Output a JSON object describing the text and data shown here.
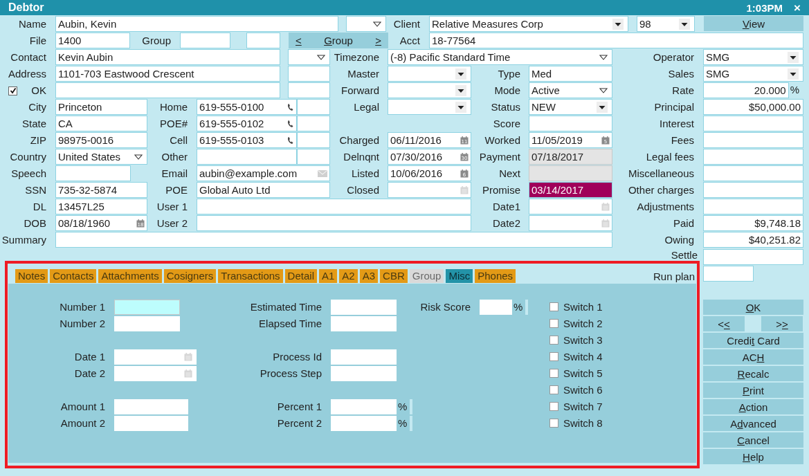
{
  "window": {
    "title": "Debtor",
    "clock": "1:03PM",
    "close": "×"
  },
  "form": {
    "items": [
      {
        "kind": "label",
        "text": "Name"
      },
      {
        "kind": "field",
        "value": "Aubin, Kevin",
        "disabled": false
      },
      {
        "kind": "combo"
      },
      {
        "kind": "label",
        "text": "Client"
      },
      {
        "kind": "select",
        "value": "Relative Measures Corp"
      },
      {
        "kind": "select",
        "value": "98"
      },
      {
        "kind": "button",
        "key": "V",
        "post": "iew"
      },
      {
        "kind": "label",
        "text": "File"
      },
      {
        "kind": "field",
        "value": "1400",
        "disabled": false
      },
      {
        "kind": "label",
        "text": "Group"
      },
      {
        "kind": "field",
        "disabled": false
      },
      {
        "kind": "field",
        "disabled": false
      },
      {
        "kind": "nav",
        "prev": "<",
        "key": "G",
        "post": "roup",
        "next": ">"
      },
      {
        "kind": "label",
        "text": "Acct"
      },
      {
        "kind": "field",
        "value": "18-77564",
        "disabled": false
      },
      {
        "kind": "label",
        "text": "Contact"
      },
      {
        "kind": "field",
        "value": "Kevin Aubin",
        "disabled": false
      },
      {
        "kind": "combo"
      },
      {
        "kind": "label",
        "text": "Timezone"
      },
      {
        "kind": "combo",
        "value": "(-8) Pacific Standard Time"
      },
      {
        "kind": "label",
        "text": "Operator"
      },
      {
        "kind": "select",
        "value": "SMG"
      },
      {
        "kind": "label",
        "text": "Address"
      },
      {
        "kind": "field",
        "value": "1101-703 Eastwood Crescent",
        "disabled": false
      },
      {
        "kind": "field",
        "disabled": false
      },
      {
        "kind": "label",
        "text": "Master"
      },
      {
        "kind": "select"
      },
      {
        "kind": "label",
        "text": "Type"
      },
      {
        "kind": "field",
        "value": "Med",
        "disabled": false
      },
      {
        "kind": "label",
        "text": "Sales"
      },
      {
        "kind": "select",
        "value": "SMG"
      },
      {
        "kind": "checkbox",
        "checked": true
      },
      {
        "kind": "label",
        "text": "OK"
      },
      {
        "kind": "field",
        "disabled": false
      },
      {
        "kind": "field",
        "disabled": false
      },
      {
        "kind": "label",
        "text": "Forward"
      },
      {
        "kind": "select"
      },
      {
        "kind": "label",
        "text": "Mode"
      },
      {
        "kind": "combo",
        "value": "Active"
      },
      {
        "kind": "label",
        "text": "Rate"
      },
      {
        "kind": "percent",
        "value": "20.000",
        "unit": "%"
      },
      {
        "kind": "label",
        "text": "City"
      },
      {
        "kind": "field",
        "value": "Princeton",
        "disabled": false
      },
      {
        "kind": "label",
        "text": "Home"
      },
      {
        "kind": "phone",
        "value": "619-555-0100"
      },
      {
        "kind": "field",
        "disabled": false
      },
      {
        "kind": "label",
        "text": "Legal"
      },
      {
        "kind": "select"
      },
      {
        "kind": "label",
        "text": "Status"
      },
      {
        "kind": "select",
        "value": "NEW"
      },
      {
        "kind": "label",
        "text": "Principal"
      },
      {
        "kind": "amount",
        "value": "$50,000.00"
      },
      {
        "kind": "label",
        "text": "State"
      },
      {
        "kind": "field",
        "value": "CA",
        "disabled": false
      },
      {
        "kind": "label",
        "text": "POE#"
      },
      {
        "kind": "phone",
        "value": "619-555-0102"
      },
      {
        "kind": "field",
        "disabled": false
      },
      {
        "kind": "label",
        "text": "Score"
      },
      {
        "kind": "field",
        "disabled": false
      },
      {
        "kind": "label",
        "text": "Interest"
      },
      {
        "kind": "amount"
      },
      {
        "kind": "label",
        "text": "ZIP"
      },
      {
        "kind": "field",
        "value": "98975-0016",
        "disabled": false
      },
      {
        "kind": "label",
        "text": "Cell"
      },
      {
        "kind": "phone",
        "value": "619-555-0103"
      },
      {
        "kind": "field",
        "disabled": false
      },
      {
        "kind": "label",
        "text": "Charged"
      },
      {
        "kind": "date",
        "value": "06/11/2016",
        "calendar_day": "11",
        "highlighted": false
      },
      {
        "kind": "label",
        "text": "Worked"
      },
      {
        "kind": "date",
        "value": "11/05/2019",
        "calendar_day": "5",
        "highlighted": false
      },
      {
        "kind": "label",
        "text": "Fees"
      },
      {
        "kind": "amount"
      },
      {
        "kind": "label",
        "text": "Country"
      },
      {
        "kind": "combo",
        "value": "United States"
      },
      {
        "kind": "label",
        "text": "Other"
      },
      {
        "kind": "field",
        "disabled": false
      },
      {
        "kind": "field",
        "disabled": false
      },
      {
        "kind": "label",
        "text": "Delnqnt"
      },
      {
        "kind": "date",
        "value": "07/30/2016",
        "calendar_day": "30",
        "highlighted": false
      },
      {
        "kind": "label",
        "text": "Payment"
      },
      {
        "kind": "field",
        "value": "07/18/2017",
        "disabled": true
      },
      {
        "kind": "label",
        "text": "Legal fees"
      },
      {
        "kind": "amount"
      },
      {
        "kind": "label",
        "text": "Speech"
      },
      {
        "kind": "field",
        "disabled": false
      },
      {
        "kind": "label",
        "text": "Email"
      },
      {
        "kind": "email",
        "value": "aubin@example.com"
      },
      {
        "kind": "label",
        "text": "Listed"
      },
      {
        "kind": "date",
        "value": "10/06/2016",
        "calendar_day": "6",
        "highlighted": false
      },
      {
        "kind": "label",
        "text": "Next"
      },
      {
        "kind": "field",
        "disabled": true
      },
      {
        "kind": "label",
        "text": "Miscellaneous"
      },
      {
        "kind": "amount"
      },
      {
        "kind": "label",
        "text": "SSN"
      },
      {
        "kind": "field",
        "value": "735-32-5874",
        "disabled": false
      },
      {
        "kind": "label",
        "text": "POE"
      },
      {
        "kind": "field",
        "value": "Global Auto Ltd",
        "disabled": false
      },
      {
        "kind": "label",
        "text": "Closed"
      },
      {
        "kind": "date",
        "highlighted": false
      },
      {
        "kind": "label",
        "text": "Promise"
      },
      {
        "kind": "date",
        "value": "03/14/2017",
        "highlighted": true
      },
      {
        "kind": "label",
        "text": "Other charges"
      },
      {
        "kind": "amount"
      },
      {
        "kind": "label",
        "text": "DL"
      },
      {
        "kind": "field",
        "value": "13457L25",
        "disabled": false
      },
      {
        "kind": "label",
        "text": "User 1"
      },
      {
        "kind": "field",
        "disabled": false
      },
      {
        "kind": "label",
        "text": "Date1"
      },
      {
        "kind": "date",
        "highlighted": false
      },
      {
        "kind": "label",
        "text": "Adjustments"
      },
      {
        "kind": "amount"
      },
      {
        "kind": "label",
        "text": "DOB"
      },
      {
        "kind": "date",
        "value": "08/18/1960",
        "calendar_day": "18",
        "highlighted": false
      },
      {
        "kind": "label",
        "text": "User 2"
      },
      {
        "kind": "field",
        "disabled": false
      },
      {
        "kind": "label",
        "text": "Date2"
      },
      {
        "kind": "date",
        "highlighted": false
      },
      {
        "kind": "label",
        "text": "Paid"
      },
      {
        "kind": "amount",
        "value": "$9,748.18"
      },
      {
        "kind": "label",
        "text": "Summary"
      },
      {
        "kind": "field",
        "disabled": false
      },
      {
        "kind": "label",
        "text": "Owing"
      },
      {
        "kind": "amount",
        "value": "$40,251.82"
      }
    ]
  },
  "side_fields": [
    {
      "label": "Settle"
    },
    {
      "label": "Run plan"
    }
  ],
  "tabs": [
    {
      "label": "Notes",
      "selected": false,
      "disabled": false
    },
    {
      "label": "Contacts",
      "selected": false,
      "disabled": false
    },
    {
      "label": "Attachments",
      "selected": false,
      "disabled": false
    },
    {
      "label": "Cosigners",
      "selected": false,
      "disabled": false
    },
    {
      "label": "Transactions",
      "selected": false,
      "disabled": false
    },
    {
      "label": "Detail",
      "selected": false,
      "disabled": false
    },
    {
      "label": "A1",
      "selected": false,
      "disabled": false
    },
    {
      "label": "A2",
      "selected": false,
      "disabled": false
    },
    {
      "label": "A3",
      "selected": false,
      "disabled": false
    },
    {
      "label": "CBR",
      "selected": false,
      "disabled": false
    },
    {
      "label": "Group",
      "selected": false,
      "disabled": true
    },
    {
      "label": "Misc",
      "selected": true,
      "disabled": false
    },
    {
      "label": "Phones",
      "selected": false,
      "disabled": false
    }
  ],
  "misc": {
    "columns": [
      [
        [
          {
            "label": "Number 1",
            "kind": "number",
            "focused": true
          },
          {
            "label": "Number 2",
            "kind": "number",
            "focused": false
          }
        ],
        [
          {
            "label": "Date 1",
            "kind": "date",
            "focused": false
          },
          {
            "label": "Date 2",
            "kind": "date",
            "focused": false
          }
        ],
        [
          {
            "label": "Amount 1",
            "kind": "amount",
            "focused": false
          },
          {
            "label": "Amount 2",
            "kind": "amount",
            "focused": false
          }
        ]
      ],
      [
        [
          {
            "label": "Estimated Time",
            "kind": "text",
            "focused": false
          },
          {
            "label": "Elapsed Time",
            "kind": "text",
            "focused": false
          }
        ],
        [
          {
            "label": "Process Id",
            "kind": "text",
            "focused": false
          },
          {
            "label": "Process Step",
            "kind": "text",
            "focused": false
          }
        ],
        [
          {
            "label": "Percent 1",
            "kind": "percent",
            "unit": "%",
            "focused": false
          },
          {
            "label": "Percent 2",
            "kind": "percent",
            "unit": "%",
            "focused": false
          }
        ]
      ],
      [
        [
          {
            "label": "Risk Score",
            "kind": "score",
            "unit": "%",
            "focused": false
          }
        ]
      ]
    ],
    "switches": [
      {
        "label": "Switch 1",
        "checked": false
      },
      {
        "label": "Switch 2",
        "checked": false
      },
      {
        "label": "Switch 3",
        "checked": false
      },
      {
        "label": "Switch 4",
        "checked": false
      },
      {
        "label": "Switch 5",
        "checked": false
      },
      {
        "label": "Switch 6",
        "checked": false
      },
      {
        "label": "Switch 7",
        "checked": false
      },
      {
        "label": "Switch 8",
        "checked": false
      }
    ]
  },
  "buttons": [
    {
      "kind": "wide",
      "key": "O",
      "post": "K"
    },
    {
      "kind": "half",
      "pre": "<",
      "key": "<"
    },
    {
      "kind": "half",
      "pre": ">",
      "key": ">"
    },
    {
      "kind": "wide",
      "pre": "Credi",
      "key": "t",
      "post": " Card"
    },
    {
      "kind": "wide",
      "pre": "AC",
      "key": "H"
    },
    {
      "kind": "wide",
      "key": "R",
      "post": "ecalc"
    },
    {
      "kind": "wide",
      "key": "P",
      "post": "rint"
    },
    {
      "kind": "wide",
      "key": "A",
      "post": "ction"
    },
    {
      "kind": "wide",
      "pre": "A",
      "key": "d",
      "post": "vanced"
    },
    {
      "kind": "wide",
      "key": "C",
      "post": "ancel"
    },
    {
      "kind": "wide",
      "key": "H",
      "post": "elp"
    }
  ]
}
